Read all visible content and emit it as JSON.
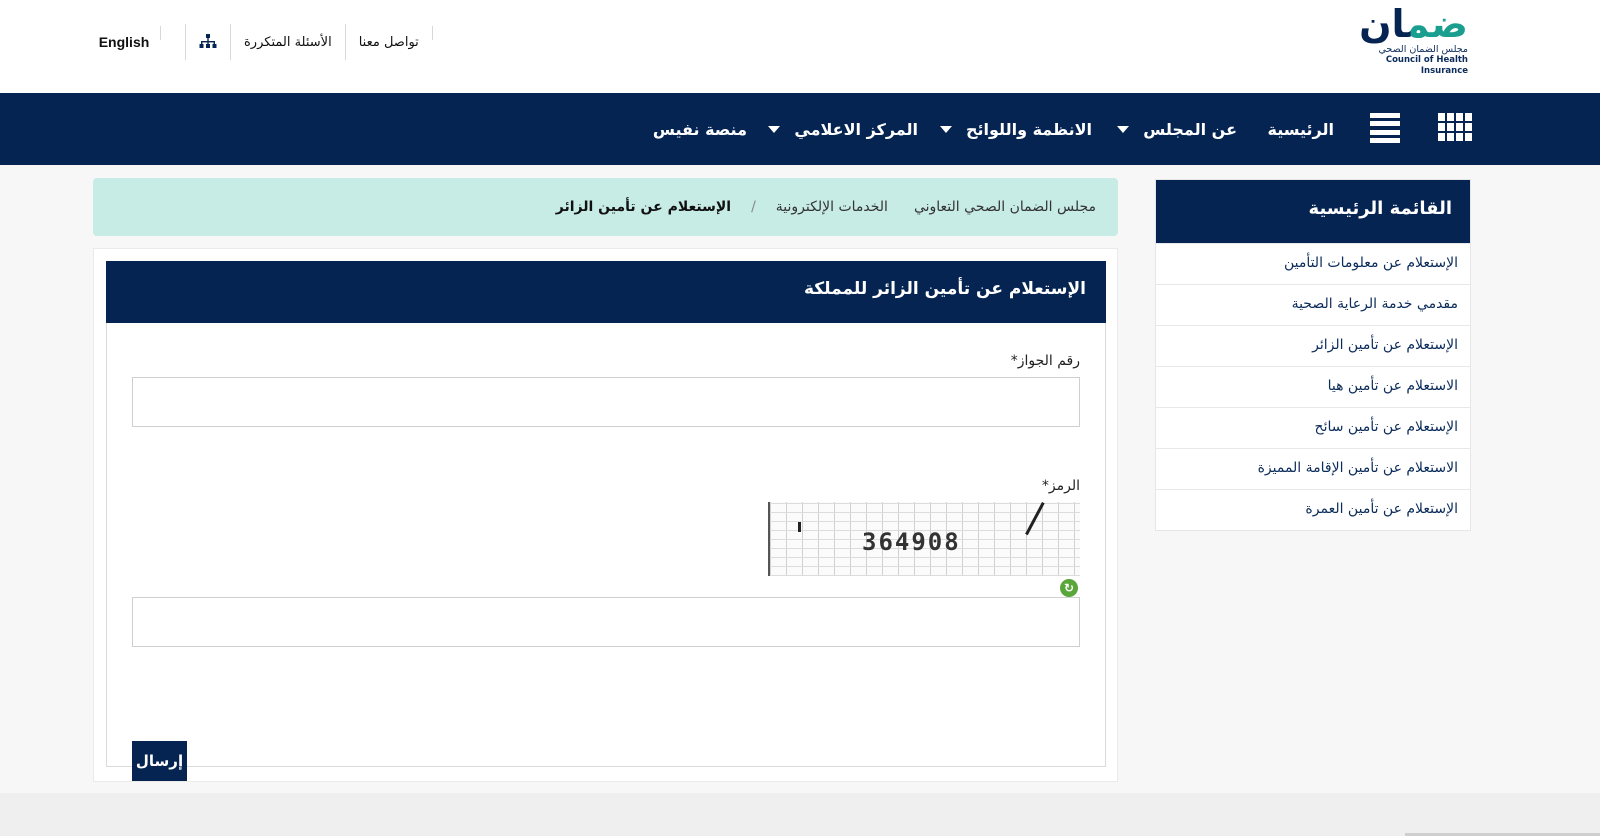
{
  "brand": {
    "logo_word": "ضمان",
    "logo_ar": "مجلس الضمان الصحي",
    "logo_en": "Council of Health Insurance",
    "colors": {
      "navy": "#062451",
      "teal": "#1a9e8f",
      "mint": "#c7ebe5",
      "green": "#5aa63b"
    }
  },
  "header": {
    "language_link": "English",
    "sitemap_icon": "sitemap-icon",
    "faq_link": "الأسئلة المتكررة",
    "contact_link": "تواصل معنا"
  },
  "nav": {
    "grid_icon": "grid-icon",
    "menu_icon": "hamburger-icon",
    "items": [
      {
        "label": "الرئيسية"
      },
      {
        "label": "عن المجلس"
      },
      {
        "label": "الانظمة واللوائح"
      },
      {
        "label": "المركز الاعلامي"
      },
      {
        "label": "منصة نفيس"
      }
    ]
  },
  "sidebar": {
    "title": "القائمة الرئيسية",
    "items": [
      {
        "label": "الإستعلام عن معلومات التأمين"
      },
      {
        "label": "مقدمي خدمة الرعاية الصحية"
      },
      {
        "label": "الإستعلام عن تأمين الزائر"
      },
      {
        "label": "الاستعلام عن تأمين هيا"
      },
      {
        "label": "الإستعلام عن تأمين سائح"
      },
      {
        "label": "الاستعلام عن تأمين الإقامة المميزة"
      },
      {
        "label": "الإستعلام عن تأمين العمرة"
      }
    ]
  },
  "breadcrumb": {
    "home": "مجلس الضمان الصحي التعاوني",
    "separator": "/",
    "section": "الخدمات الإلكترونية",
    "current": "الإستعلام عن تأمين الزائر"
  },
  "form": {
    "title": "الإستعلام عن تأمين الزائر للمملكة",
    "passport_label": "رقم الجواز*",
    "passport_value": "",
    "captcha_label": "الرمز*",
    "captcha_code": "364908",
    "captcha_value": "",
    "refresh_icon": "refresh-icon",
    "submit_label": "إرسال"
  }
}
